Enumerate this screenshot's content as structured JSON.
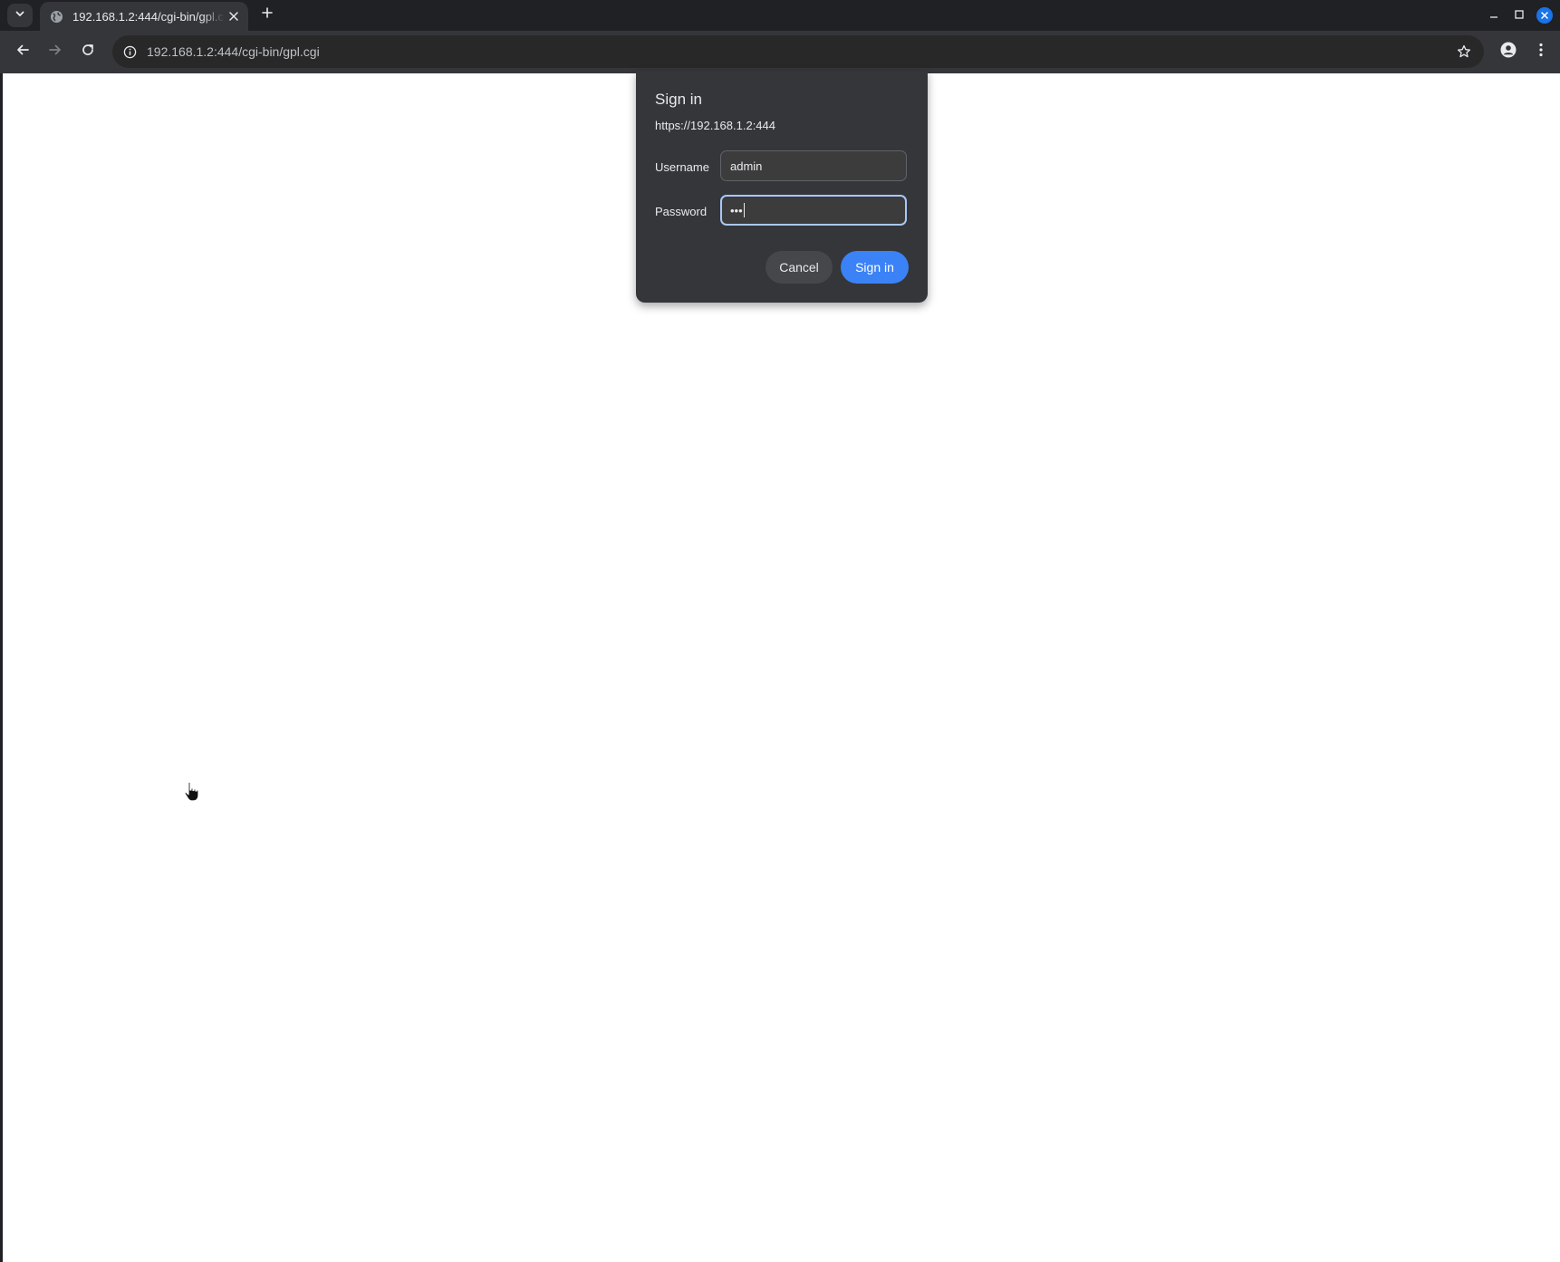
{
  "browser": {
    "tab": {
      "title": "192.168.1.2:444/cgi-bin/gpl.cgi",
      "favicon": "globe-icon"
    },
    "address_bar": {
      "url": "192.168.1.2:444/cgi-bin/gpl.cgi"
    },
    "icons": {
      "tab_search": "chevron-down-icon",
      "tab_close": "close-icon",
      "new_tab": "plus-icon",
      "back": "arrow-left-icon",
      "forward": "arrow-right-icon",
      "reload": "reload-icon",
      "site_info": "info-icon",
      "bookmark": "star-icon",
      "profile": "person-icon",
      "menu": "kebab-menu-icon",
      "minimize": "minimize-icon",
      "maximize": "maximize-icon",
      "window_close": "close-icon"
    }
  },
  "dialog": {
    "title": "Sign in",
    "origin": "https://192.168.1.2:444",
    "username_label": "Username",
    "username_value": "admin",
    "password_label": "Password",
    "password_value": "•••",
    "cancel_label": "Cancel",
    "signin_label": "Sign in"
  },
  "colors": {
    "accent": "#3b82f6",
    "focus_ring": "#a8c7fa",
    "chrome_dark": "#202124",
    "dialog_bg": "#35363a"
  }
}
